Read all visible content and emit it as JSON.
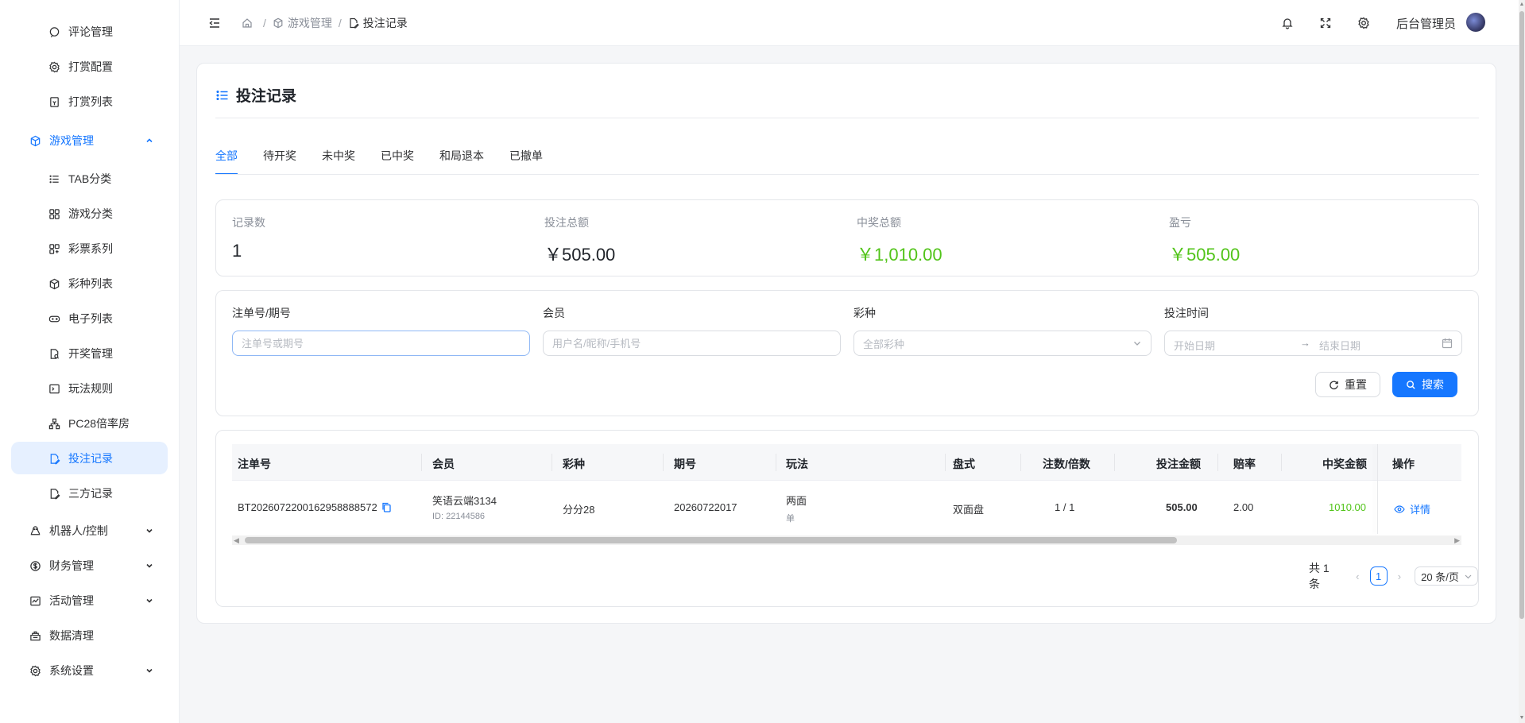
{
  "sidebar": {
    "items": [
      {
        "label": "评论管理",
        "icon": "comment-icon",
        "level": "sub"
      },
      {
        "label": "打赏配置",
        "icon": "gear-icon",
        "level": "sub"
      },
      {
        "label": "打赏列表",
        "icon": "receipt-icon",
        "level": "sub"
      },
      {
        "label": "游戏管理",
        "icon": "cube-icon",
        "level": "top",
        "expanded": true
      },
      {
        "label": "TAB分类",
        "icon": "list-icon",
        "level": "sub"
      },
      {
        "label": "游戏分类",
        "icon": "grid-icon",
        "level": "sub"
      },
      {
        "label": "彩票系列",
        "icon": "grid-alt-icon",
        "level": "sub"
      },
      {
        "label": "彩种列表",
        "icon": "cube-icon",
        "level": "sub"
      },
      {
        "label": "电子列表",
        "icon": "gamepad-icon",
        "level": "sub"
      },
      {
        "label": "开奖管理",
        "icon": "doc-search-icon",
        "level": "sub"
      },
      {
        "label": "玩法规则",
        "icon": "terminal-icon",
        "level": "sub"
      },
      {
        "label": "PC28倍率房",
        "icon": "network-icon",
        "level": "sub"
      },
      {
        "label": "投注记录",
        "icon": "doc-edit-icon",
        "level": "sub",
        "active": true
      },
      {
        "label": "三方记录",
        "icon": "doc-edit-icon",
        "level": "sub"
      },
      {
        "label": "机器人/控制",
        "icon": "robot-icon",
        "level": "top"
      },
      {
        "label": "财务管理",
        "icon": "dollar-icon",
        "level": "top"
      },
      {
        "label": "活动管理",
        "icon": "activity-icon",
        "level": "top"
      },
      {
        "label": "数据清理",
        "icon": "database-icon",
        "level": "top"
      },
      {
        "label": "系统设置",
        "icon": "settings-icon",
        "level": "top"
      }
    ]
  },
  "header": {
    "breadcrumb": [
      "游戏管理",
      "投注记录"
    ],
    "user_name": "后台管理员"
  },
  "page": {
    "title": "投注记录",
    "tabs": [
      "全部",
      "待开奖",
      "未中奖",
      "已中奖",
      "和局退本",
      "已撤单"
    ],
    "active_tab": 0
  },
  "stats": [
    {
      "label": "记录数",
      "value": "1",
      "color": "#1f2329"
    },
    {
      "label": "投注总额",
      "value": "￥505.00",
      "color": "#1f2329"
    },
    {
      "label": "中奖总额",
      "value": "￥1,010.00",
      "color": "#52c41a"
    },
    {
      "label": "盈亏",
      "value": "￥505.00",
      "color": "#52c41a"
    }
  ],
  "filters": {
    "order_label": "注单号/期号",
    "order_placeholder": "注单号或期号",
    "member_label": "会员",
    "member_placeholder": "用户名/昵称/手机号",
    "lottery_label": "彩种",
    "lottery_placeholder": "全部彩种",
    "time_label": "投注时间",
    "start_placeholder": "开始日期",
    "end_placeholder": "结束日期",
    "reset_label": "重置",
    "search_label": "搜索"
  },
  "table": {
    "columns": [
      "注单号",
      "会员",
      "彩种",
      "期号",
      "玩法",
      "盘式",
      "注数/倍数",
      "投注金额",
      "赔率",
      "中奖金额",
      "操作"
    ],
    "rows": [
      {
        "order_no": "BT2026072200162958888572",
        "member_name": "笑语云端3134",
        "member_id": "ID: 22144586",
        "lottery": "分分28",
        "period": "20260722017",
        "play": "两面",
        "play_sub": "单",
        "mode": "双面盘",
        "count": "1 / 1",
        "amount": "505.00",
        "odds": "2.00",
        "win": "1010.00",
        "action": "详情"
      }
    ]
  },
  "pagination": {
    "total": "共 1 条",
    "current": "1",
    "page_size": "20 条/页"
  },
  "colors": {
    "accent": "#1677ff",
    "win_green": "#52c41a"
  }
}
